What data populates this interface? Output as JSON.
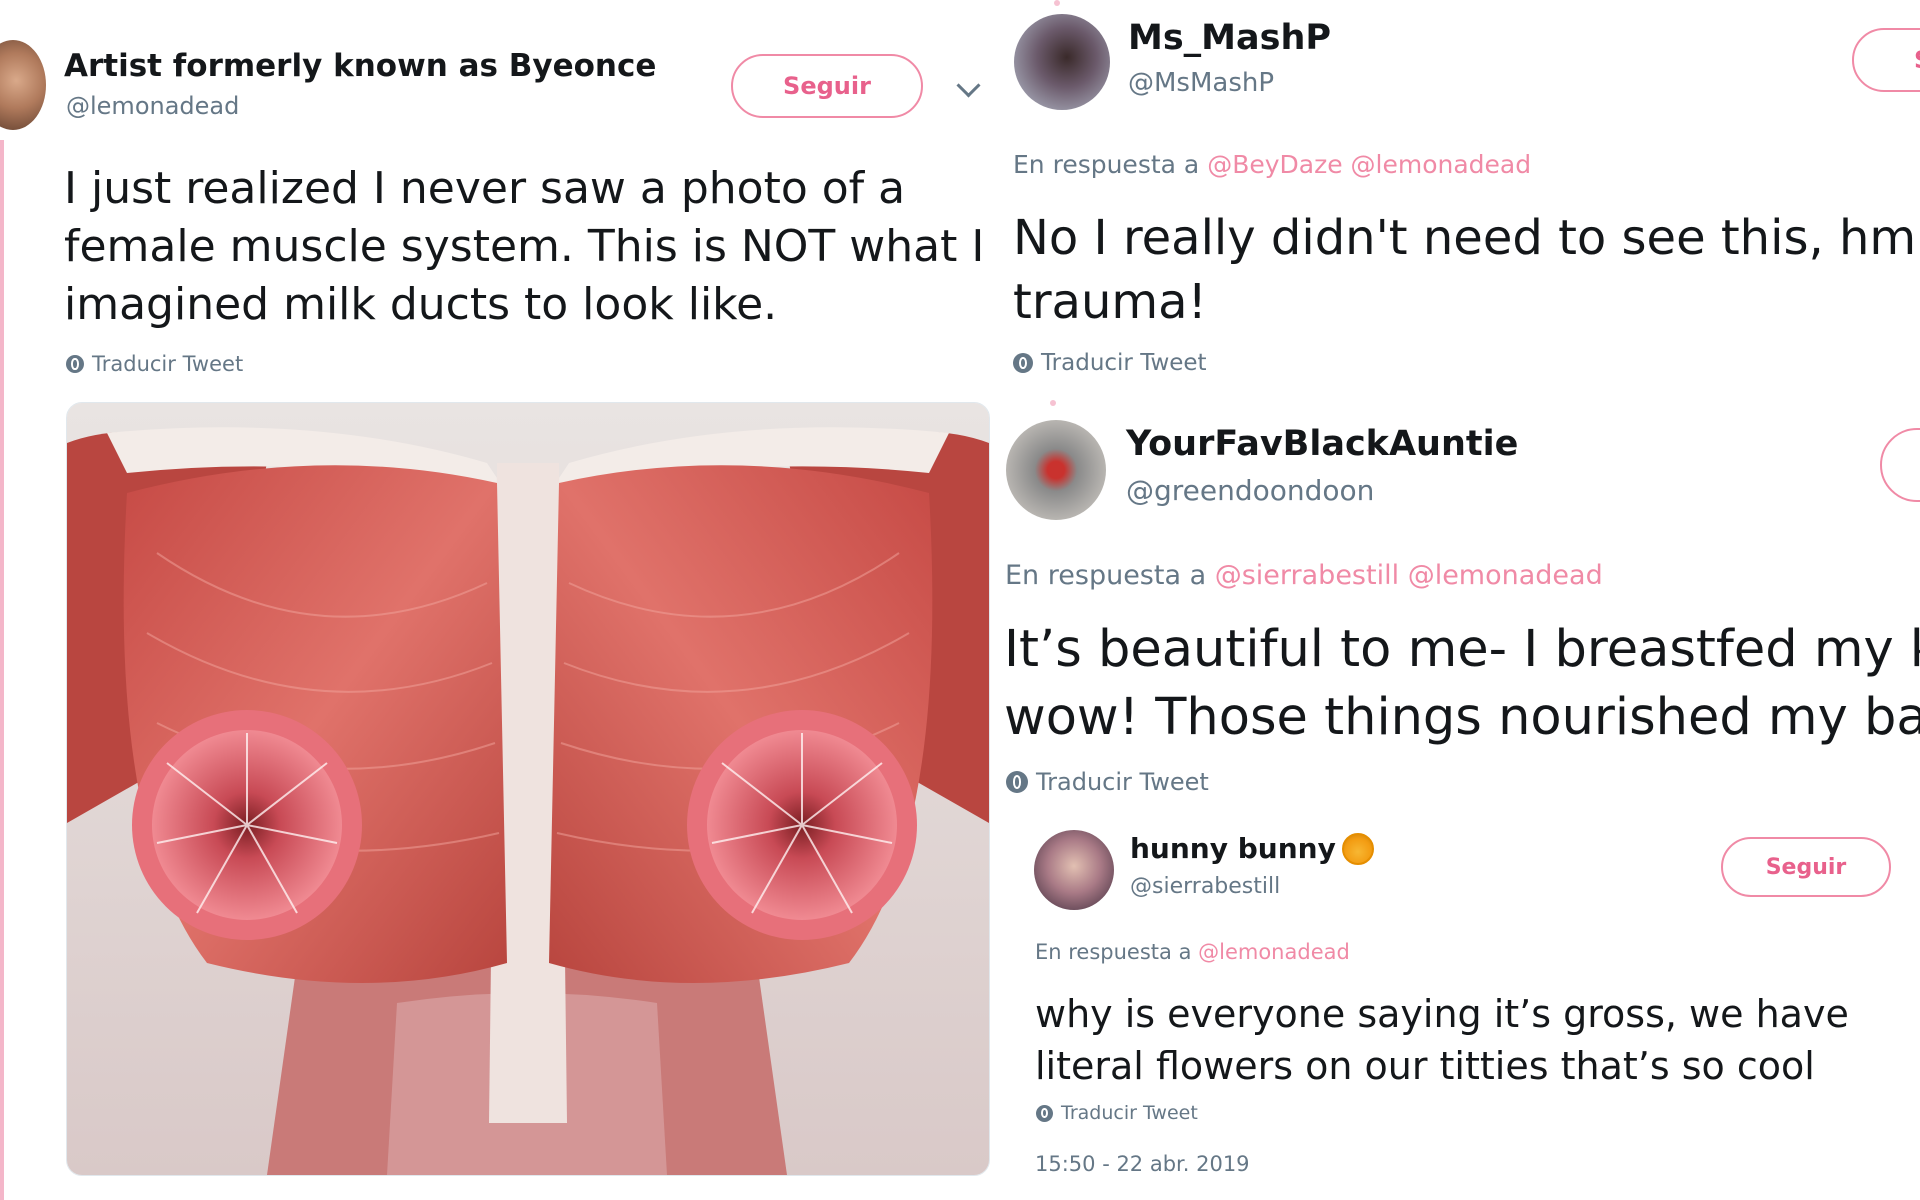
{
  "left_tweet": {
    "name": "Artist formerly known as Byeonce",
    "handle": "@lemonadead",
    "follow_label": "Seguir",
    "text_lines": [
      "I just realized I never saw a photo of a",
      "female muscle system. This is NOT what I",
      "imagined milk ducts to look like."
    ],
    "translate_label": "Traducir Tweet"
  },
  "reply1": {
    "name": "Ms_MashP",
    "handle": "@MsMashP",
    "follow_label": "S",
    "reply_prefix": "En respuesta a",
    "mentions": [
      "@BeyDaze",
      "@lemonadead"
    ],
    "text_lines": [
      "No I really didn't need to see this, hm",
      "trauma!"
    ],
    "translate_label": "Traducir Tweet"
  },
  "reply2": {
    "name": "YourFavBlackAuntie",
    "handle": "@greendoondoon",
    "reply_prefix": "En respuesta a",
    "mentions": [
      "@sierrabestill",
      "@lemonadead"
    ],
    "text_lines": [
      "It’s beautiful to me- I breastfed my k",
      "wow! Those things nourished my bal"
    ],
    "translate_label": "Traducir Tweet"
  },
  "reply3": {
    "name": "hunny bunny",
    "name_emoji": "honey-pot-emoji",
    "handle": "@sierrabestill",
    "follow_label": "Seguir",
    "reply_prefix": "En respuesta a",
    "mentions": [
      "@lemonadead"
    ],
    "text_lines": [
      "why is everyone saying it’s gross, we have",
      "literal flowers on our titties that’s so cool"
    ],
    "translate_label": "Traducir Tweet",
    "timestamp": "15:50 - 22 abr. 2019"
  },
  "colors": {
    "accent": "#e8618c",
    "mention": "#f08aa6",
    "muted": "#657786",
    "thread_line": "#f4b6c9"
  }
}
